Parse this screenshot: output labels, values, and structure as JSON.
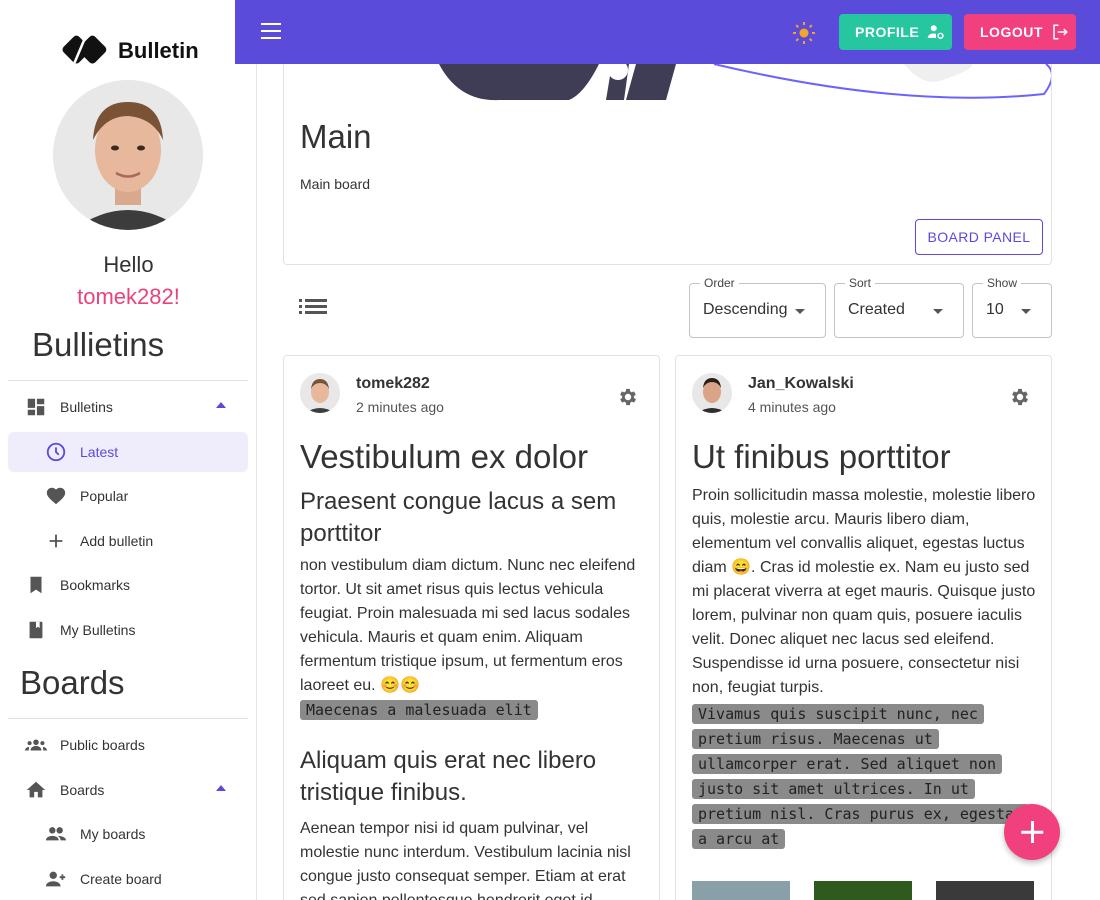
{
  "app": {
    "brand": "Bulletin"
  },
  "user": {
    "greeting": "Hello",
    "username": "tomek282!"
  },
  "header": {
    "profile_label": "PROFILE",
    "logout_label": "LOGOUT"
  },
  "sidebar": {
    "bulletins_heading": "Bullietins",
    "boards_heading": "Boards",
    "items": [
      {
        "label": "Bulletins",
        "icon": "dashboard-icon"
      },
      {
        "label": "Latest",
        "icon": "clock-icon"
      },
      {
        "label": "Popular",
        "icon": "heart-icon"
      },
      {
        "label": "Add bulletin",
        "icon": "plus-icon"
      },
      {
        "label": "Bookmarks",
        "icon": "bookmark-icon"
      },
      {
        "label": "My Bulletins",
        "icon": "book-icon"
      },
      {
        "label": "Public boards",
        "icon": "groups-icon"
      },
      {
        "label": "Boards",
        "icon": "home-icon"
      },
      {
        "label": "My boards",
        "icon": "people-icon"
      },
      {
        "label": "Create board",
        "icon": "person-add-icon"
      }
    ]
  },
  "board": {
    "title": "Main",
    "description": "Main board",
    "panel_label": "BOARD PANEL"
  },
  "filters": {
    "order": {
      "label": "Order",
      "value": "Descending"
    },
    "sort": {
      "label": "Sort",
      "value": "Created"
    },
    "show": {
      "label": "Show",
      "value": "10"
    }
  },
  "posts": [
    {
      "author": "tomek282",
      "time": "2 minutes ago",
      "title": "Vestibulum ex dolor",
      "subtitle": "Praesent congue lacus a sem porttitor",
      "text1": "non vestibulum diam dictum. Nunc nec eleifend tortor. Ut sit amet risus quis lectus vehicula feugiat. Proin malesuada mi sed lacus sodales vehicula. Mauris et quam enim. Aliquam fermentum tristique ipsum, ut fermentum eros laoreet eu. 😊😊",
      "code": "Maecenas a malesuada elit",
      "heading2": "Aliquam quis erat nec libero tristique finibus.",
      "text2": "Aenean tempor nisi id quam pulvinar, vel molestie nunc interdum. Vestibulum lacinia nisl congue justo consequat semper. Etiam at erat sed sapien pellentesque hendrerit eget id"
    },
    {
      "author": "Jan_Kowalski",
      "time": "4 minutes ago",
      "title": "Ut finibus porttitor",
      "text1": "Proin sollicitudin massa molestie, molestie libero quis, molestie arcu. Mauris libero diam, elementum vel convallis aliquet, egestas luctus diam 😄. Cras id molestie ex. Nam eu justo sed mi placerat viverra at eget mauris. Quisque justo lorem, pulvinar non quam quis, posuere iaculis velit. Donec aliquet nec lacus sed eleifend. Suspendisse id urna posuere, consectetur nisi non, feugiat turpis.",
      "code": "Vivamus quis suscipit nunc, nec pretium risus. Maecenas ut ullamcorper erat. Sed aliquet non justo sit amet ultrices. In ut pretium nisl. Cras purus ex, egestas a arcu at"
    }
  ],
  "colors": {
    "primary": "#5b4bdb",
    "accent": "#f23f7e",
    "success": "#26c6a0"
  }
}
